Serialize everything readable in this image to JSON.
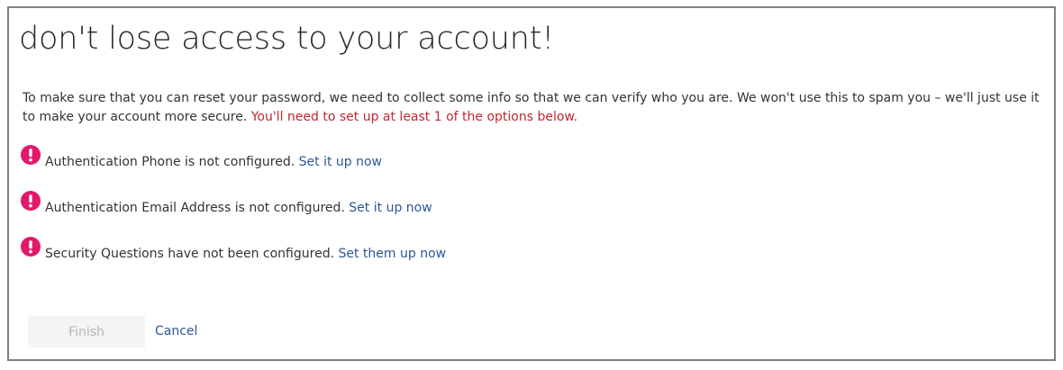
{
  "page": {
    "title": "don't lose access to your account!",
    "intro_text": "To make sure that you can reset your password, we need to collect some info so that we can verify who you are. We won't use this to spam you – we'll just use it to make your account more secure. ",
    "intro_warning": "You'll need to set up at least 1 of the options below."
  },
  "methods": [
    {
      "status_text": "Authentication Phone is not configured. ",
      "link_label": "Set it up now",
      "icon": "alert-icon"
    },
    {
      "status_text": "Authentication Email Address is not configured. ",
      "link_label": "Set it up now",
      "icon": "alert-icon"
    },
    {
      "status_text": "Security Questions have not been configured. ",
      "link_label": "Set them up now",
      "icon": "alert-icon"
    }
  ],
  "actions": {
    "finish_label": "Finish",
    "cancel_label": "Cancel"
  },
  "colors": {
    "alert": "#e3186b",
    "link": "#2b5797",
    "warning_text": "#c4262e"
  }
}
